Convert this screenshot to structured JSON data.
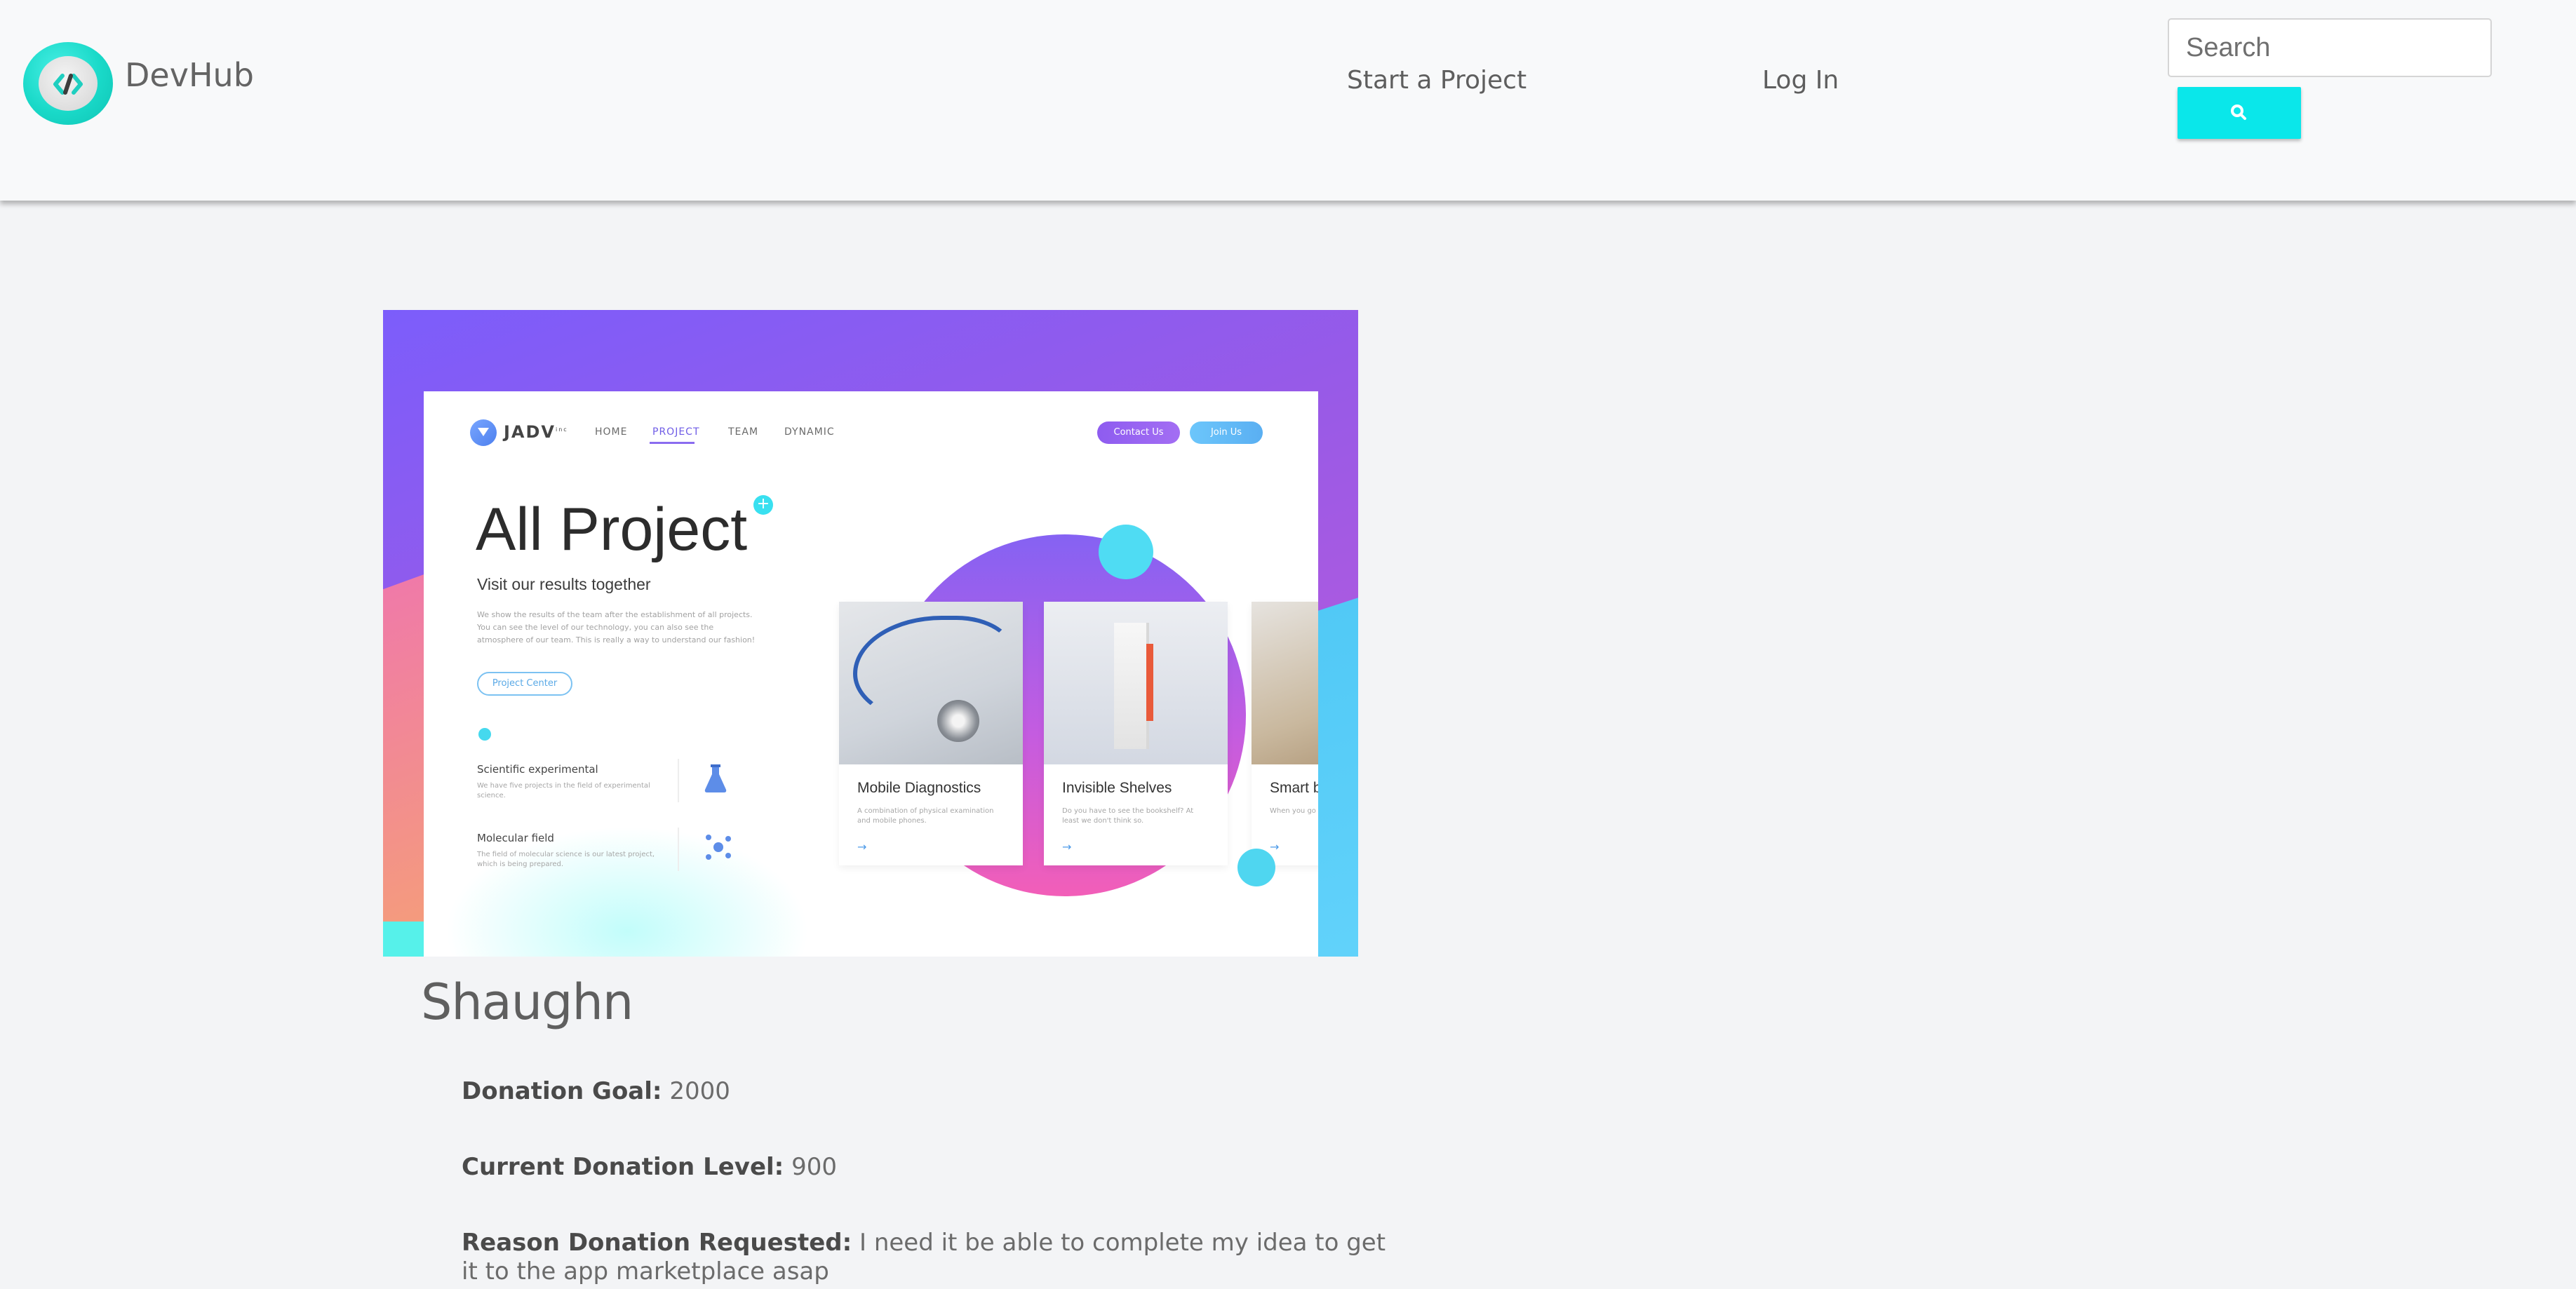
{
  "header": {
    "brand": "DevHub",
    "nav": {
      "start_project": "Start a Project",
      "log_in": "Log In"
    },
    "search": {
      "placeholder": "Search"
    }
  },
  "hero_image": {
    "brand": "JADV",
    "brand_sup": "inc",
    "nav": [
      "HOME",
      "PROJECT",
      "TEAM",
      "DYNAMIC"
    ],
    "buttons": {
      "contact": "Contact Us",
      "join": "Join Us"
    },
    "title": "All Project",
    "subtitle": "Visit our results together",
    "paragraph": "We show the results of the team after the establishment of all projects. You can see the level of our technology, you can also see the atmosphere of our team. This is really a way to understand our fashion!",
    "project_center": "Project Center",
    "items": [
      {
        "title": "Scientific experimental",
        "desc": "We have five projects in the field of experimental science."
      },
      {
        "title": "Molecular field",
        "desc": "The field of molecular science is our latest project, which is being prepared."
      }
    ],
    "cards": [
      {
        "title": "Mobile Diagnostics",
        "desc": "A combination of physical examination and mobile phones."
      },
      {
        "title": "Invisible Shelves",
        "desc": "Do you have to see the bookshelf? At least we don't think so."
      },
      {
        "title": "Smart b",
        "desc": "When you go breakfast bef"
      }
    ]
  },
  "project": {
    "name": "Shaughn",
    "goal_label": "Donation Goal:",
    "goal_value": "2000",
    "level_label": "Current Donation Level:",
    "level_value": "900",
    "reason_label": "Reason Donation Requested:",
    "reason_value": "I need it be able to complete my idea to get it to the app marketplace asap"
  }
}
